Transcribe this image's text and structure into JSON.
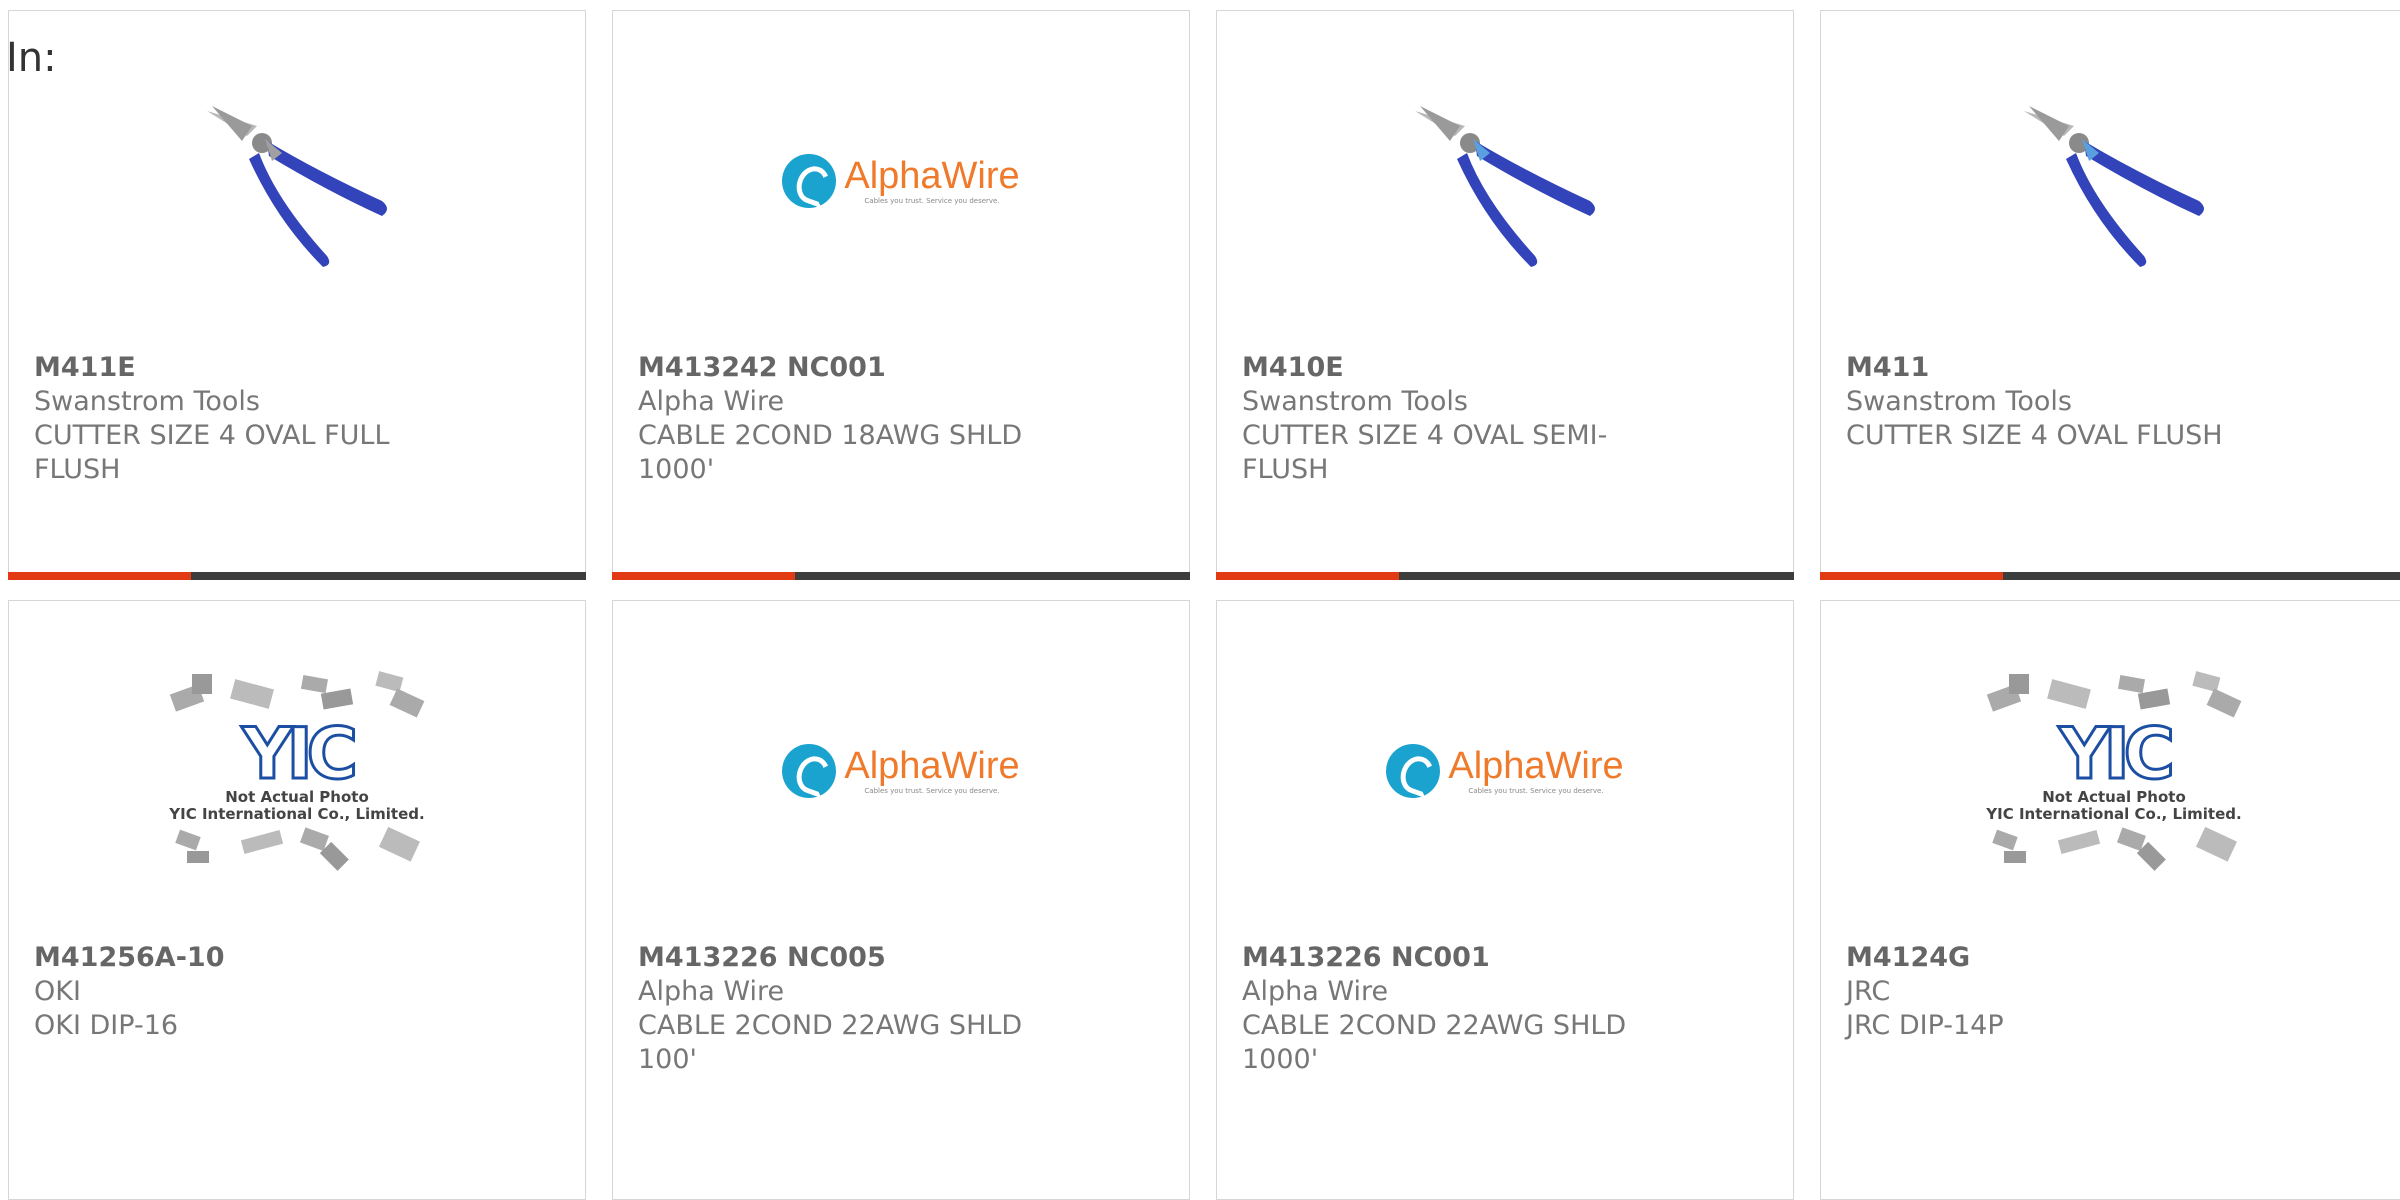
{
  "page": {
    "in_label": "In:"
  },
  "cards": [
    {
      "part": "M411E",
      "manufacturer": "Swanstrom Tools",
      "description": "CUTTER SIZE 4 OVAL FULL FLUSH",
      "image": "pliers-icon"
    },
    {
      "part": "M413242 NC001",
      "manufacturer": "Alpha Wire",
      "description": "CABLE 2COND 18AWG SHLD 1000'",
      "image": "alphawire-logo"
    },
    {
      "part": "M410E",
      "manufacturer": "Swanstrom Tools",
      "description": "CUTTER SIZE 4 OVAL SEMI-FLUSH",
      "image": "pliers-icon"
    },
    {
      "part": "M411",
      "manufacturer": "Swanstrom Tools",
      "description": "CUTTER SIZE 4 OVAL FLUSH",
      "image": "pliers-icon"
    },
    {
      "part": "M41256A-10",
      "manufacturer": "OKI",
      "description": "OKI DIP-16",
      "image": "yic-placeholder"
    },
    {
      "part": "M413226 NC005",
      "manufacturer": "Alpha Wire",
      "description": "CABLE 2COND 22AWG SHLD 100'",
      "image": "alphawire-logo"
    },
    {
      "part": "M413226 NC001",
      "manufacturer": "Alpha Wire",
      "description": "CABLE 2COND 22AWG SHLD 1000'",
      "image": "alphawire-logo"
    },
    {
      "part": "M4124G",
      "manufacturer": "JRC",
      "description": "JRC DIP-14P",
      "image": "yic-placeholder"
    }
  ],
  "logos": {
    "alphawire": {
      "name": "AlphaWire",
      "tagline": "Cables you trust. Service you deserve."
    },
    "yic": {
      "mark": "YIC",
      "caption_line1": "Not Actual Photo",
      "caption_line2": "YIC International Co., Limited."
    }
  },
  "colors": {
    "accent": "#e23a12",
    "bar": "#3d3d3d",
    "alphawire_blue": "#1aa3cf",
    "alphawire_orange": "#f07a2b",
    "pliers_blue": "#3344bb"
  }
}
